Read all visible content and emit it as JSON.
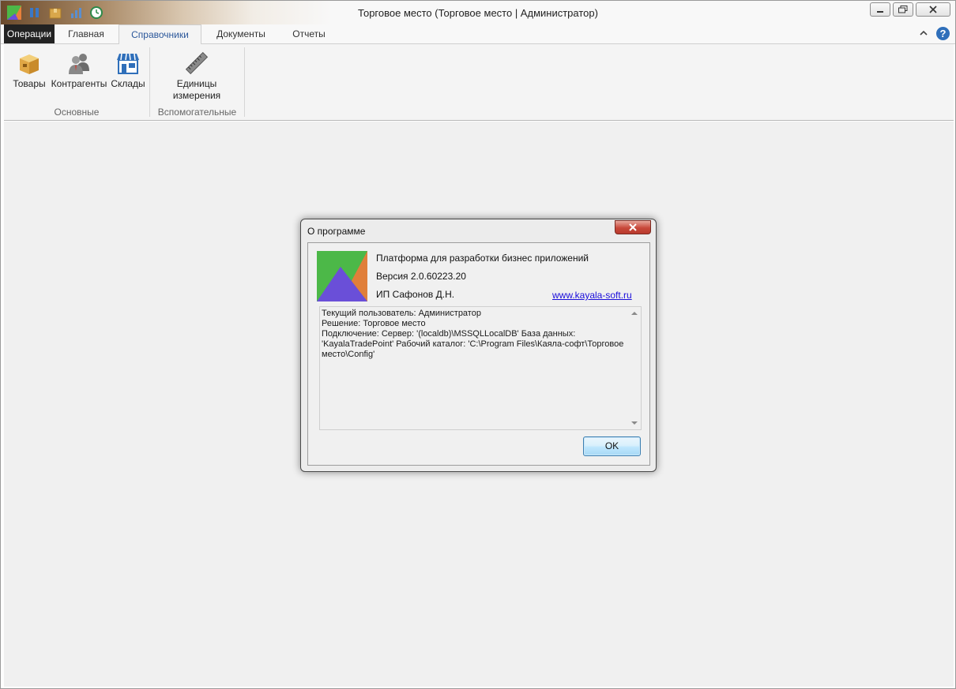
{
  "window": {
    "title": "Торговое место (Торговое место | Администратор)"
  },
  "ribbon": {
    "file_tab": "Операции",
    "tabs": [
      {
        "label": "Главная"
      },
      {
        "label": "Справочники",
        "active": true
      },
      {
        "label": "Документы"
      },
      {
        "label": "Отчеты"
      }
    ],
    "help_label": "?",
    "groups": [
      {
        "label": "Основные",
        "buttons": [
          {
            "label": "Товары",
            "icon": "goods-box-icon"
          },
          {
            "label": "Контрагенты",
            "icon": "contractors-people-icon"
          },
          {
            "label": "Склады",
            "icon": "warehouse-store-icon"
          }
        ]
      },
      {
        "label": "Вспомогательные",
        "buttons": [
          {
            "label": "Единицы измерения",
            "icon": "ruler-icon"
          }
        ]
      }
    ]
  },
  "about_dialog": {
    "title": "О программе",
    "product_line": "Платформа для разработки бизнес приложений",
    "version_line": "Версия 2.0.60223.20",
    "author_line": "ИП Сафонов Д.Н.",
    "website_link": "www.kayala-soft.ru",
    "info_text": "Текущий пользователь: Администратор\nРешение: Торговое место\nПодключение: Сервер: '(localdb)\\MSSQLLocalDB' База данных: 'KayalaTradePoint' Рабочий каталог: 'C:\\Program Files\\Каяла-софт\\Торговое место\\Config'",
    "ok_label": "OK"
  },
  "colors": {
    "accent": "#2b579a",
    "file_tab_bg": "#222222",
    "link": "#1a0ddb",
    "close_button": "#c8483a"
  }
}
